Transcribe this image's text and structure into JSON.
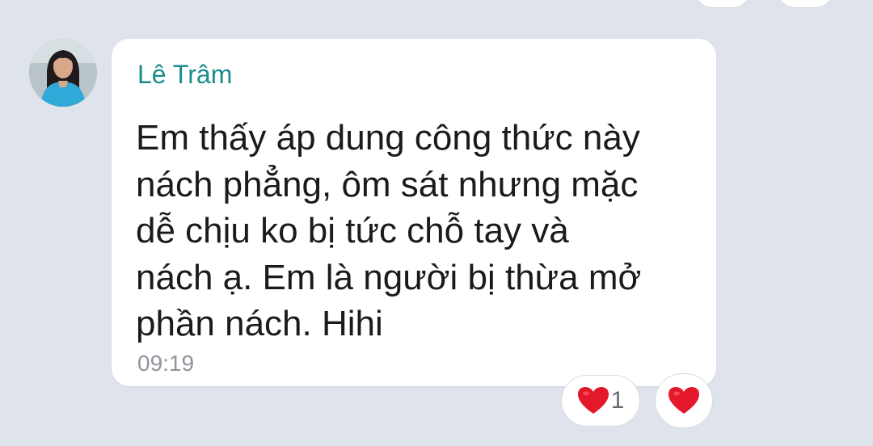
{
  "message": {
    "sender": "Lê Trâm",
    "lines": [
      "Em thấy áp dung công thức này",
      "nách phẳng, ôm sát nhưng mặc",
      "dễ chịu ko bị tức chỗ tay và",
      "nách ạ. Em là người bị thừa mở",
      "phần nách. Hihi"
    ],
    "time": "09:19"
  },
  "reactions": {
    "count": "1",
    "icon": "heart-icon",
    "color": "#e3192b"
  },
  "colors": {
    "background": "#dfe4ec",
    "bubble": "#ffffff",
    "sender_name": "#1b8c8c",
    "timestamp": "#8f959c"
  }
}
